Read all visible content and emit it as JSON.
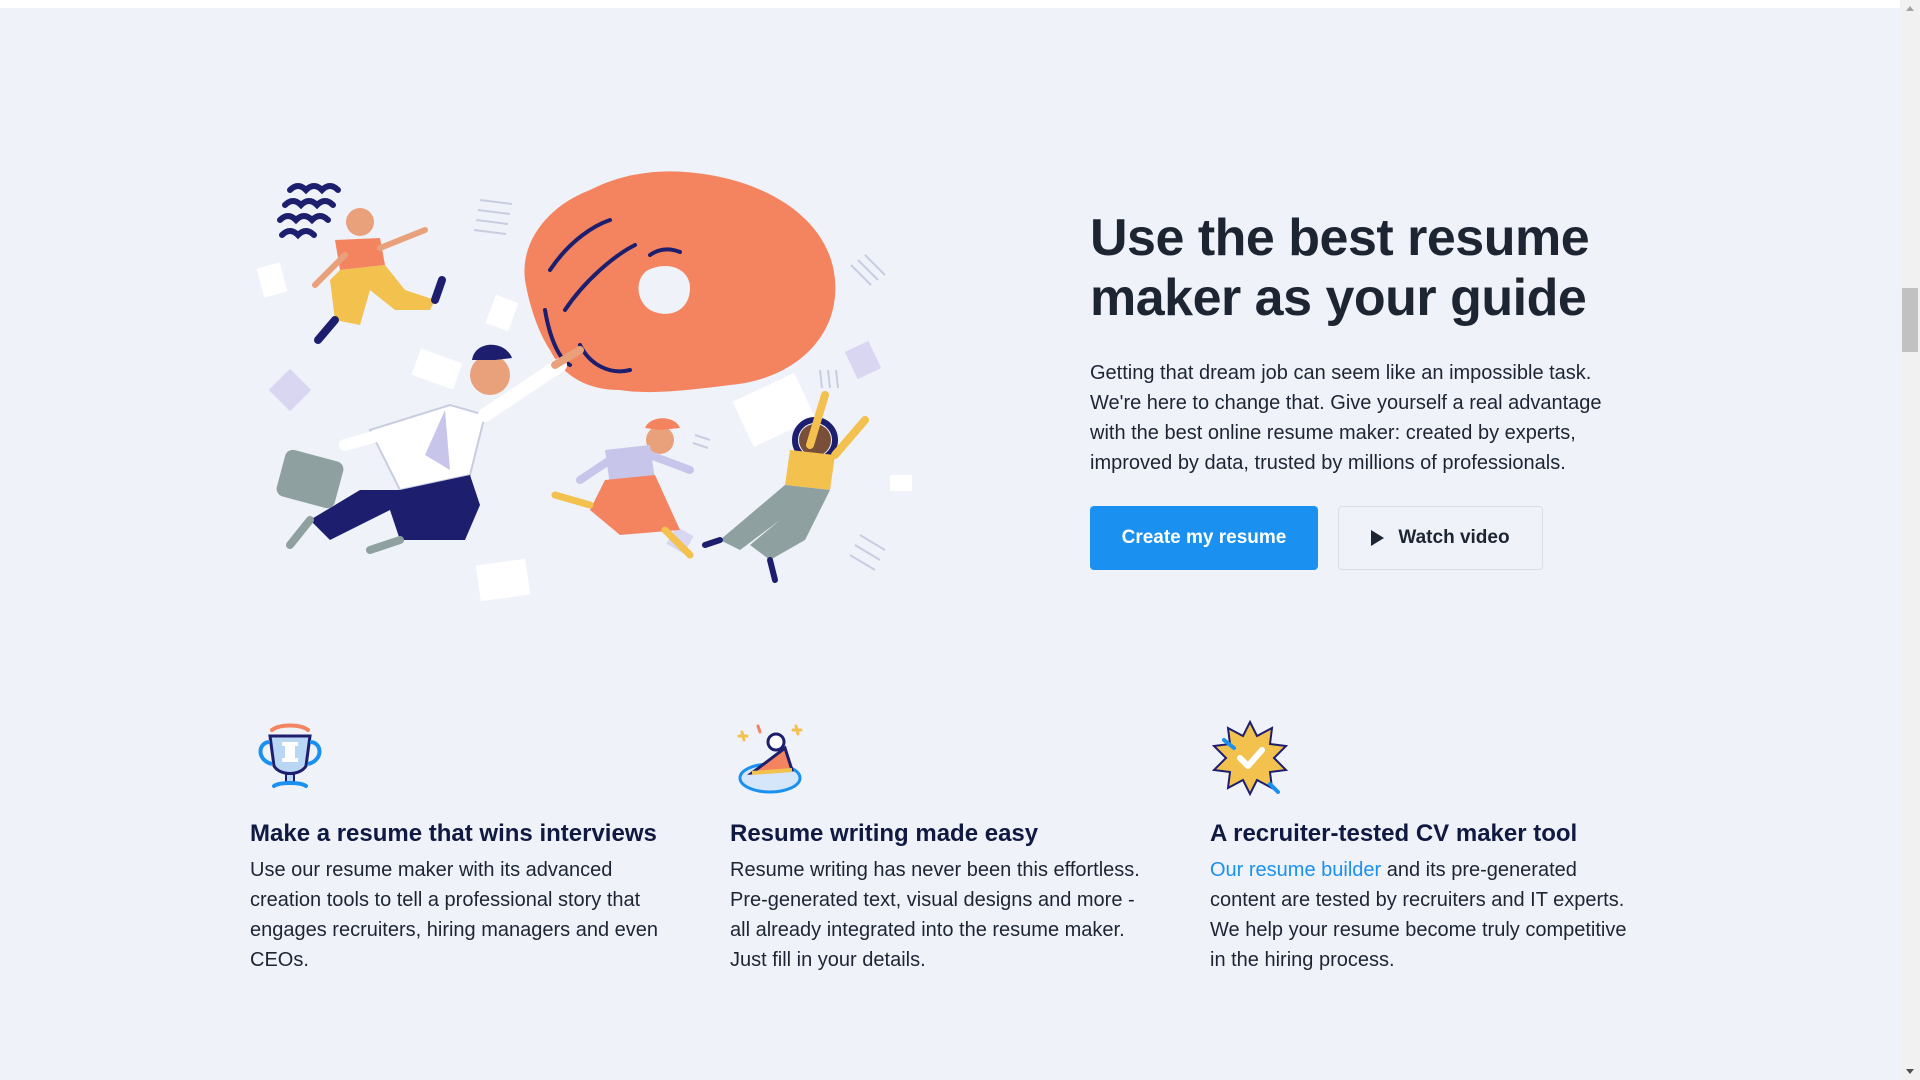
{
  "hero": {
    "title": "Use the best resume maker as your guide",
    "description": "Getting that dream job can seem like an impossible task. We're here to change that. Give yourself a real advantage with the best online resume maker: created by experts, improved by data, trusted by millions of professionals.",
    "primary_button": "Create my resume",
    "secondary_button": "Watch video",
    "illustration": "people-reaching-for-giant-hand-illustration"
  },
  "features": [
    {
      "icon": "trophy-icon",
      "title": "Make a resume that wins interviews",
      "description": "Use our resume maker with its advanced creation tools to tell a professional story that engages recruiters, hiring managers and even CEOs."
    },
    {
      "icon": "cake-slice-icon",
      "title": "Resume writing made easy",
      "description": "Resume writing has never been this effortless. Pre-generated text, visual designs and more - all already integrated into the resume maker. Just fill in your details."
    },
    {
      "icon": "checkmark-badge-icon",
      "title": "A recruiter-tested CV maker tool",
      "link_text": "Our resume builder",
      "description": " and its pre-generated content are tested by recruiters and IT experts. We help your resume become truly competitive in the hiring process."
    }
  ],
  "colors": {
    "background": "#eff2f9",
    "accent": "#1a91f0",
    "heading": "#0f1941",
    "text": "#1e2532",
    "orange": "#f4845f",
    "navy": "#1d1f6e"
  }
}
